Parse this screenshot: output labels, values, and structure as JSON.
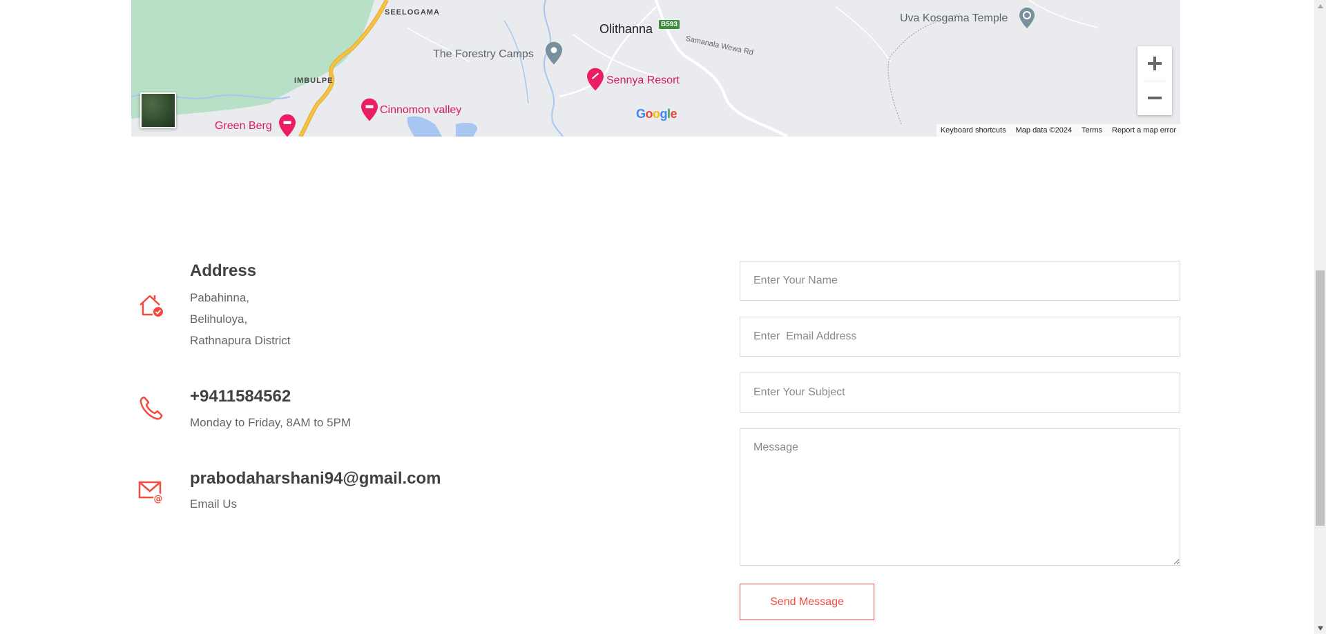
{
  "map": {
    "labels": {
      "seelogama": "SEELOGAMA",
      "olithanna": "Olithanna",
      "road_badge": "B593",
      "road_name": "Samanala Wewa Rd",
      "uva_kosgama": "Uva Kosgama Temple",
      "forestry_camps": "The Forestry Camps",
      "imbulpe": "IMBULPE",
      "sennya_resort": "Sennya Resort",
      "cinnomon_valley": "Cinnomon valley",
      "green_berg": "Green Berg"
    },
    "google_logo": "Google",
    "zoom_in": "+",
    "zoom_out": "−",
    "attribution": {
      "keyboard_shortcuts": "Keyboard shortcuts",
      "map_data": "Map data ©2024",
      "terms": "Terms",
      "report_error": "Report a map error"
    },
    "colors": {
      "land": "#e9ebee",
      "park": "#b8e0c7",
      "water": "#a7c6f2",
      "highway": "#f5c242",
      "poi_pink": "#d81b60"
    }
  },
  "contact": {
    "address": {
      "title": "Address",
      "lines": [
        "Pabahinna,",
        "Belihuloya,",
        "Rathnapura District"
      ]
    },
    "phone": {
      "title": "+9411584562",
      "subtitle": "Monday to Friday, 8AM to 5PM"
    },
    "email": {
      "title": "prabodaharshani94@gmail.com",
      "subtitle": "Email Us"
    },
    "icon_color": "#f44a40"
  },
  "form": {
    "name_placeholder": "Enter Your Name",
    "email_placeholder": "Enter  Email Address",
    "subject_placeholder": "Enter Your Subject",
    "message_placeholder": "Message",
    "submit_label": "Send Message",
    "accent": "#f44a40"
  }
}
